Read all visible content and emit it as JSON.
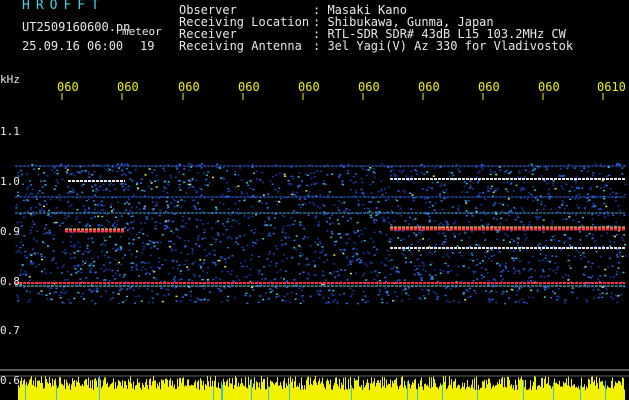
{
  "header": {
    "title": "HROFFT",
    "filename": "UT2509160600.pn",
    "tag": "meteor",
    "date_time": "25.09.16 06:00",
    "count": "19"
  },
  "info": {
    "observer_label": "Observer",
    "observer_value": ": Masaki Kano",
    "location_label": "Receiving Location",
    "location_value": ": Shibukawa, Gunma, Japan",
    "receiver_label": "Receiver",
    "receiver_value": ": RTL-SDR SDR# 43dB L15 103.2MHz CW",
    "antenna_label": "Receiving Antenna",
    "antenna_value": ": 3el Yagi(V) Az 330 for Vladivostok"
  },
  "axis": {
    "unit": "kHz",
    "time_ticks": [
      "060",
      "060",
      "060",
      "060",
      "060",
      "060",
      "060",
      "060",
      "060",
      "0610"
    ],
    "freq_labels": [
      "1.1",
      "1.0",
      "0.9",
      "0.8",
      "0.7",
      "0.6"
    ]
  },
  "colors": {
    "label_cyan": "#38d7e8",
    "tick_yellow": "#f2f200",
    "signal_red": "#ff3040",
    "noise_blue": "#1a4bd8",
    "background": "#000000"
  }
}
